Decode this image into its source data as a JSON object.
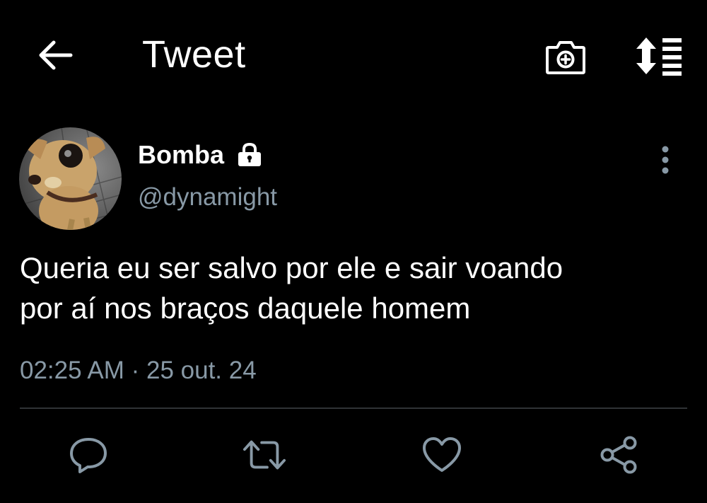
{
  "header": {
    "title": "Tweet",
    "back_icon": "arrow-left-icon",
    "camera_icon": "camera-add-icon",
    "sort_icon": "sort-updown-icon"
  },
  "tweet": {
    "author_name": "Bomba",
    "author_handle": "@dynamight",
    "protected_icon": "lock-icon",
    "text_line1": "Queria eu ser salvo por ele e sair voando",
    "text_line2": "por aí nos braços daquele homem",
    "timestamp": "02:25 AM · 25 out. 24"
  },
  "actions": {
    "reply_icon": "reply-icon",
    "retweet_icon": "retweet-icon",
    "like_icon": "heart-icon",
    "share_icon": "share-icon"
  },
  "colors": {
    "background": "#000000",
    "text_primary": "#ffffff",
    "text_secondary": "#8899a6",
    "divider": "#2f3336"
  }
}
